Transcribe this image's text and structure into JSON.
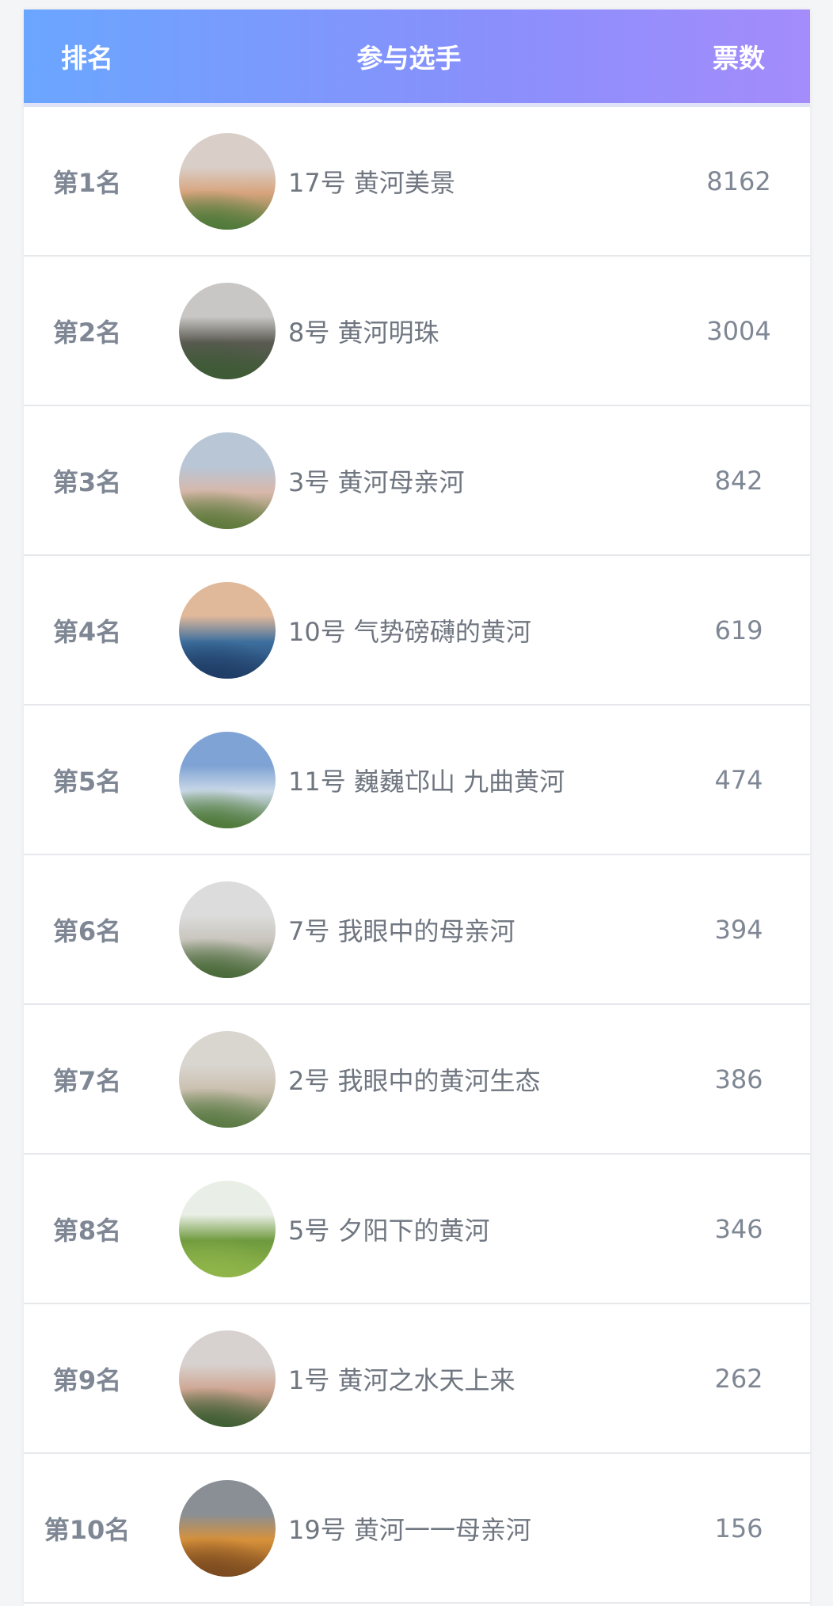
{
  "header": {
    "rank": "排名",
    "player": "参与选手",
    "votes": "票数"
  },
  "rows": [
    {
      "rank": "第1名",
      "name": "17号 黄河美景",
      "votes": "8162",
      "image_colors": [
        "#d9cfc8",
        "#d8a47d",
        "#4f7a3a"
      ]
    },
    {
      "rank": "第2名",
      "name": "8号 黄河明珠",
      "votes": "3004",
      "image_colors": [
        "#c9c7c5",
        "#5a5a52",
        "#3d5a35"
      ]
    },
    {
      "rank": "第3名",
      "name": "3号 黄河母亲河",
      "votes": "842",
      "image_colors": [
        "#b8c6d6",
        "#d8b8aa",
        "#5f7a3c"
      ]
    },
    {
      "rank": "第4名",
      "name": "10号 气势磅礴的黄河",
      "votes": "619",
      "image_colors": [
        "#e0b89a",
        "#3d6f9e",
        "#1f3d66"
      ]
    },
    {
      "rank": "第5名",
      "name": "11号 巍巍邙山 九曲黄河",
      "votes": "474",
      "image_colors": [
        "#7fa3d4",
        "#cbd9e8",
        "#4f7a3a"
      ]
    },
    {
      "rank": "第6名",
      "name": "7号 我眼中的母亲河",
      "votes": "394",
      "image_colors": [
        "#dcdcdc",
        "#c8c4bc",
        "#4a6a3a"
      ]
    },
    {
      "rank": "第7名",
      "name": "2号 我眼中的黄河生态",
      "votes": "386",
      "image_colors": [
        "#d9d6d0",
        "#cabfae",
        "#5a7a44"
      ]
    },
    {
      "rank": "第8名",
      "name": "5号 夕阳下的黄河",
      "votes": "346",
      "image_colors": [
        "#e9efe6",
        "#6f9a3e",
        "#8fb54a"
      ]
    },
    {
      "rank": "第9名",
      "name": "1号 黄河之水天上来",
      "votes": "262",
      "image_colors": [
        "#d7d2cf",
        "#cfa592",
        "#3f5e33"
      ]
    },
    {
      "rank": "第10名",
      "name": "19号 黄河一一母亲河",
      "votes": "156",
      "image_colors": [
        "#8a8f95",
        "#d7913a",
        "#7b4a1f"
      ]
    }
  ]
}
